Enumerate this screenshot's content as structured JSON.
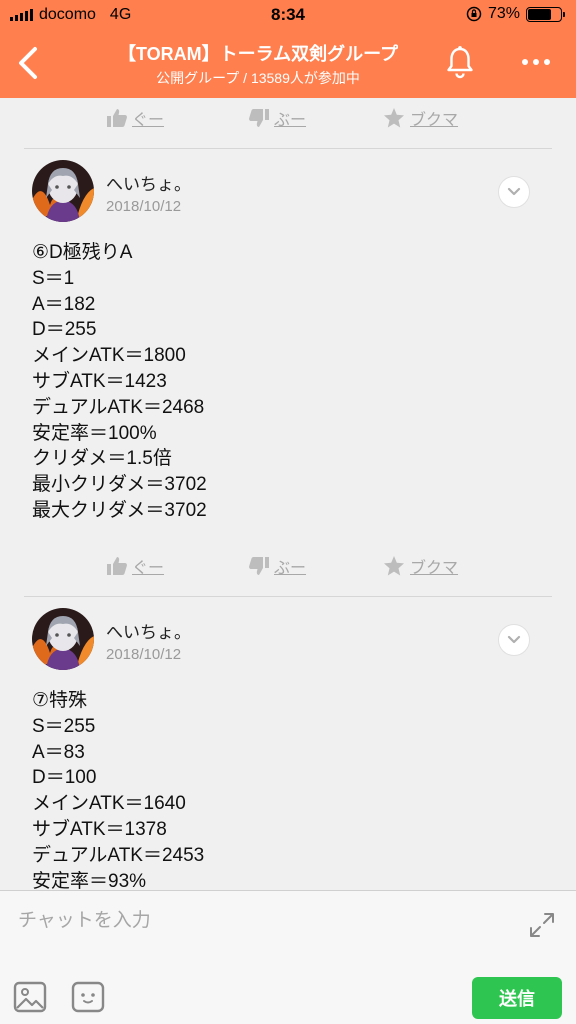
{
  "status_bar": {
    "carrier": "docomo",
    "network": "4G",
    "time": "8:34",
    "battery": "73%",
    "battery_level": 0.73
  },
  "header": {
    "title": "【TORAM】トーラム双剣グループ",
    "subtitle": "公開グループ / 13589人が参加中"
  },
  "reactions": {
    "good": "ぐー",
    "bad": "ぶー",
    "bookmark": "ブクマ"
  },
  "posts": [
    {
      "author": "へいちょ。",
      "date": "2018/10/12",
      "lines": [
        "⑥D極残りA",
        "S＝1",
        "A＝182",
        "D＝255",
        "メインATK＝1800",
        "サブATK＝1423",
        "デュアルATK＝2468",
        "安定率＝100%",
        "クリダメ＝1.5倍",
        "最小クリダメ＝3702",
        "最大クリダメ＝3702"
      ]
    },
    {
      "author": "へいちょ。",
      "date": "2018/10/12",
      "lines": [
        "⑦特殊",
        "S＝255",
        "A＝83",
        "D＝100",
        "メインATK＝1640",
        "サブATK＝1378",
        "デュアルATK＝2453",
        "安定率＝93%"
      ]
    }
  ],
  "composer": {
    "placeholder": "チャットを入力",
    "send_label": "送信"
  },
  "colors": {
    "header": "#ff7f4e",
    "send": "#2ec650"
  }
}
